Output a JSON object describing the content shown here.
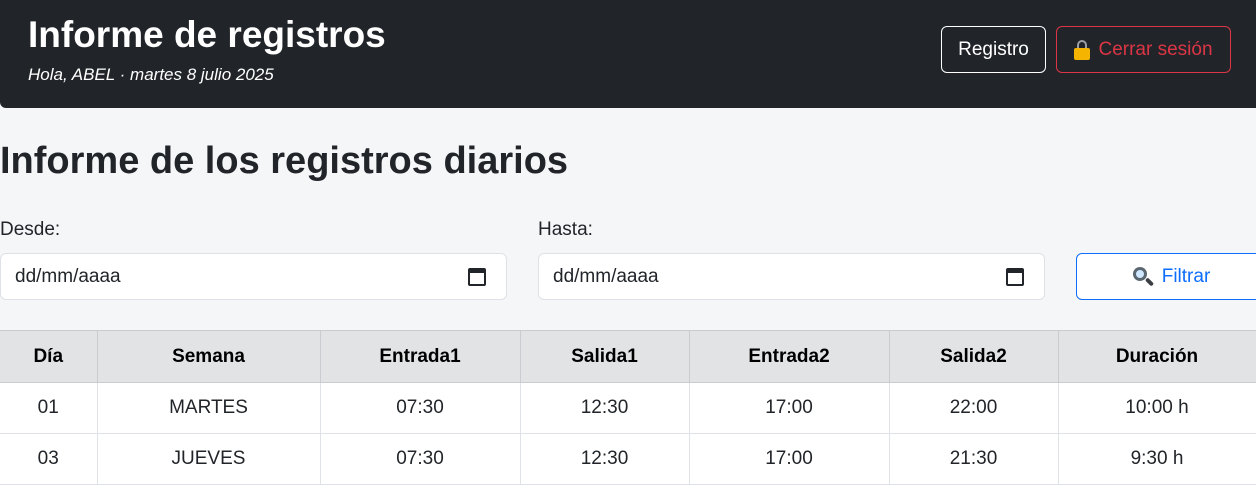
{
  "header": {
    "title": "Informe de registros",
    "subtitle": "Hola, ABEL · martes 8 julio 2025",
    "registro_label": "Registro",
    "logout_label": "Cerrar sesión"
  },
  "main": {
    "title": "Informe de los registros diarios",
    "from_label": "Desde:",
    "from_value": "dd/mm/aaaa",
    "to_label": "Hasta:",
    "to_value": "dd/mm/aaaa",
    "filter_label": "Filtrar"
  },
  "table": {
    "headers": [
      "Día",
      "Semana",
      "Entrada1",
      "Salida1",
      "Entrada2",
      "Salida2",
      "Duración"
    ],
    "rows": [
      [
        "01",
        "MARTES",
        "07:30",
        "12:30",
        "17:00",
        "22:00",
        "10:00 h"
      ],
      [
        "03",
        "JUEVES",
        "07:30",
        "12:30",
        "17:00",
        "21:30",
        "9:30 h"
      ]
    ]
  },
  "colors": {
    "header_bg": "#212529",
    "danger": "#dc3545",
    "primary": "#0d6efd"
  },
  "icons": [
    "lock-icon",
    "calendar-icon",
    "magnifier-icon"
  ]
}
